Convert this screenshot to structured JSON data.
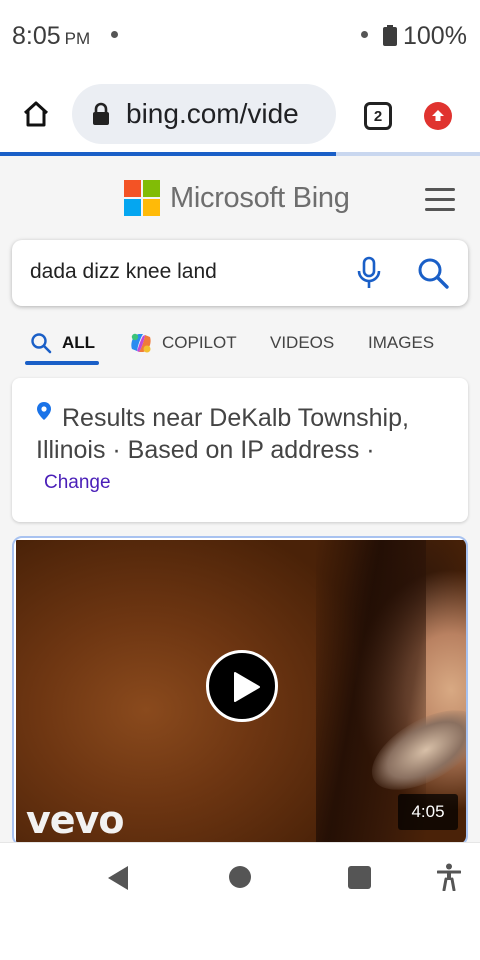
{
  "status_bar": {
    "time": "8:05",
    "ampm": "PM",
    "battery": "100%"
  },
  "browser": {
    "url": "bing.com/vide",
    "tab_count": "2",
    "load_progress": 0.7
  },
  "bing": {
    "brand": "Microsoft Bing",
    "logo_colors": [
      "#f35325",
      "#81bc06",
      "#05a6f0",
      "#ffba08"
    ],
    "accent_color": "#1a5fc7",
    "search": {
      "query": "dada dizz knee land"
    },
    "tabs": [
      {
        "label": "ALL",
        "active": true
      },
      {
        "label": "COPILOT",
        "active": false
      },
      {
        "label": "VIDEOS",
        "active": false
      },
      {
        "label": "IMAGES",
        "active": false
      }
    ],
    "location": {
      "text": "Results near DeKalb Township, Illinois  ·  Based on IP address ·",
      "change_label": "Change"
    },
    "video": {
      "channel": "vevo",
      "duration": "4:05"
    }
  },
  "icons": {
    "home": "home-icon",
    "lock": "lock-icon",
    "tabs": "tab-switcher-icon",
    "update": "update-icon",
    "menu": "hamburger-menu-icon",
    "mic": "microphone-icon",
    "search": "search-icon",
    "copilot": "copilot-icon",
    "pin": "location-pin-icon",
    "play": "play-icon",
    "back": "back-triangle-icon",
    "accessibility": "accessibility-icon"
  }
}
